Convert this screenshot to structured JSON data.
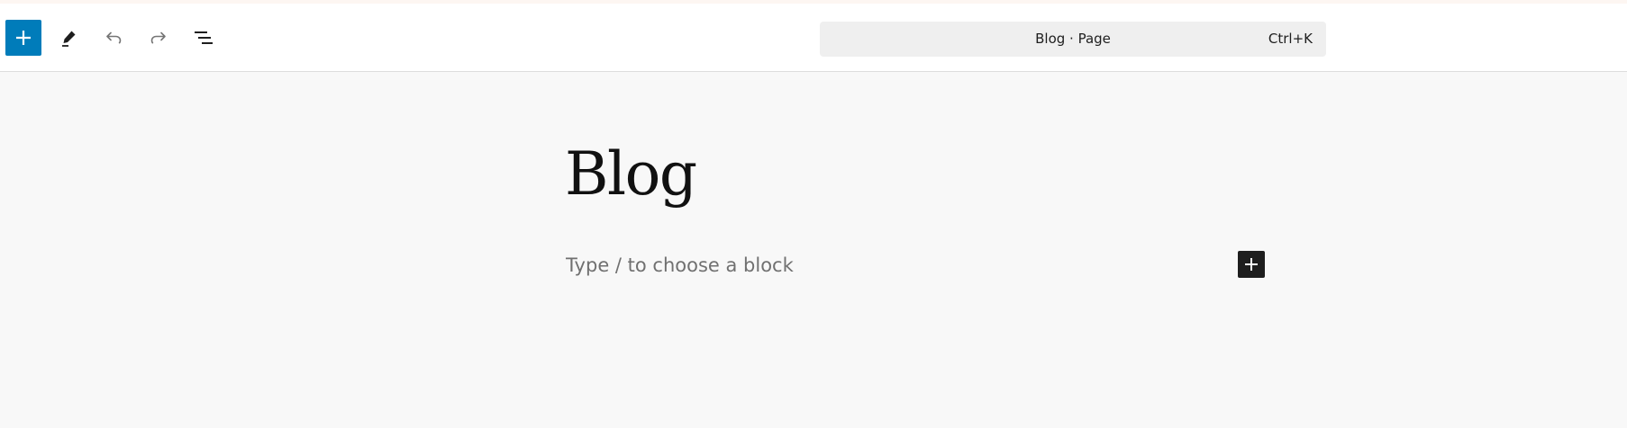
{
  "toolbar": {
    "inserter": {
      "icon": "plus-icon",
      "color": "#007cba"
    },
    "tools": {
      "icon": "pencil-icon"
    },
    "undo": {
      "icon": "undo-icon"
    },
    "redo": {
      "icon": "redo-icon"
    },
    "list_view": {
      "icon": "list-view-icon"
    }
  },
  "command_bar": {
    "title": "Blog · Page",
    "shortcut": "Ctrl+K"
  },
  "editor": {
    "post_title": "Blog",
    "appender_placeholder": "Type / to choose a block",
    "inline_inserter_icon": "plus-icon"
  }
}
